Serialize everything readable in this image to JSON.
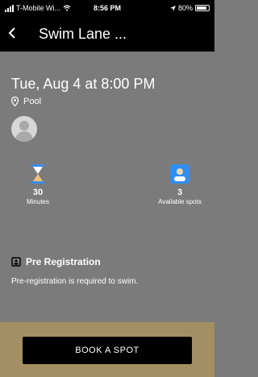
{
  "status_bar": {
    "carrier": "T-Mobile Wi...",
    "time": "8:56 PM",
    "battery": "80%"
  },
  "nav": {
    "back_icon": "chevron-left-icon",
    "title": "Swim Lane ..."
  },
  "event": {
    "datetime": "Tue, Aug 4 at 8:00 PM",
    "location": "Pool"
  },
  "stats": {
    "duration": {
      "value": "30",
      "label": "Minutes",
      "icon": "hourglass-icon"
    },
    "spots": {
      "value": "3",
      "label": "Available spots",
      "icon": "person-badge-icon"
    }
  },
  "prereg": {
    "icon": "badge-icon",
    "title": "Pre Registration",
    "description": "Pre-registration is required to swim."
  },
  "footer": {
    "cta_label": "BOOK A SPOT"
  },
  "colors": {
    "header": "#000000",
    "content_bg": "#7b7b7b",
    "footer_bg": "#a38f63",
    "accent_blue": "#2f8ff0"
  }
}
